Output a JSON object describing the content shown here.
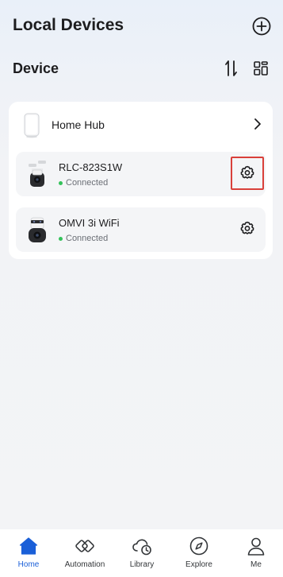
{
  "header": {
    "title": "Local Devices",
    "add_icon": "plus-circle-icon"
  },
  "section": {
    "title": "Device",
    "sort_icon": "sort-arrows-icon",
    "layout_icon": "grid-layout-icon"
  },
  "hub": {
    "label": "Home Hub",
    "icon": "home-hub-icon",
    "chevron": "chevron-right-icon"
  },
  "devices": [
    {
      "name": "RLC-823S1W",
      "status": "Connected",
      "icon": "camera-icon",
      "settings_icon": "gear-icon",
      "settings_highlighted": true
    },
    {
      "name": "OMVI 3i WiFi",
      "status": "Connected",
      "icon": "camera-icon",
      "settings_icon": "gear-icon",
      "settings_highlighted": false
    }
  ],
  "nav": {
    "active": "Home",
    "items": [
      {
        "label": "Home",
        "icon": "home-icon"
      },
      {
        "label": "Automation",
        "icon": "automation-icon"
      },
      {
        "label": "Library",
        "icon": "cloud-clock-icon"
      },
      {
        "label": "Explore",
        "icon": "compass-icon"
      },
      {
        "label": "Me",
        "icon": "person-icon"
      }
    ]
  },
  "colors": {
    "accent": "#1a5fd8",
    "status_connected": "#34c25a",
    "highlight_border": "#d9403a",
    "card_bg": "#ffffff",
    "row_bg": "#f4f5f7"
  }
}
